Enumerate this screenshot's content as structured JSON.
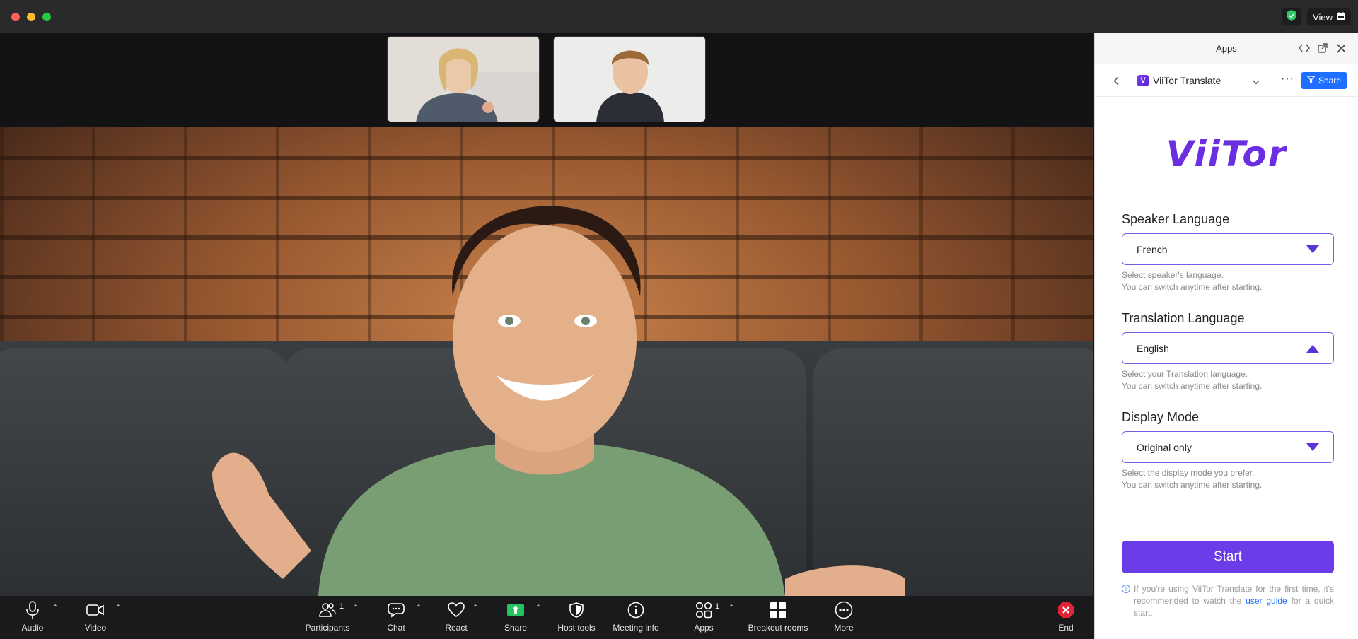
{
  "titlebar": {
    "view_label": "View"
  },
  "toolbar": {
    "audio": "Audio",
    "video": "Video",
    "participants": "Participants",
    "participants_count": "1",
    "chat": "Chat",
    "react": "React",
    "share": "Share",
    "host_tools": "Host tools",
    "meeting_info": "Meeting info",
    "apps": "Apps",
    "apps_count": "1",
    "breakout_rooms": "Breakout rooms",
    "more": "More",
    "end": "End"
  },
  "panel": {
    "title": "Apps",
    "app_name": "ViiTor Translate",
    "app_icon_letter": "V",
    "share_label": "Share",
    "brand": "ViiTor",
    "speaker": {
      "label": "Speaker Language",
      "value": "French",
      "hint1": "Select speaker's language.",
      "hint2": "You can switch anytime after starting."
    },
    "translation": {
      "label": "Translation Language",
      "value": "English",
      "hint1": "Select your Translation language.",
      "hint2": "You can switch anytime after starting."
    },
    "display": {
      "label": "Display Mode",
      "value": "Original only",
      "hint1": "Select the display mode you prefer.",
      "hint2": "You can switch anytime after starting."
    },
    "start_label": "Start",
    "footnote_pre": "If you're using ViiTor Translate for the first time, it's recommended to watch the ",
    "footnote_link": "user guide",
    "footnote_post": " for a quick start."
  },
  "colors": {
    "accent": "#6b3de8",
    "share_blue": "#1e6fff",
    "end_red": "#e0243a"
  },
  "icons": [
    "shield-icon",
    "calendar-icon",
    "microphone-icon",
    "camera-icon",
    "participants-icon",
    "chat-icon",
    "heart-icon",
    "share-arrow-icon",
    "host-shield-icon",
    "info-icon",
    "apps-icon",
    "grid-icon",
    "ellipsis-icon",
    "end-x-icon",
    "code-icon",
    "popout-icon",
    "close-icon",
    "back-chevron-icon",
    "chevron-down-icon",
    "funnel-icon"
  ]
}
